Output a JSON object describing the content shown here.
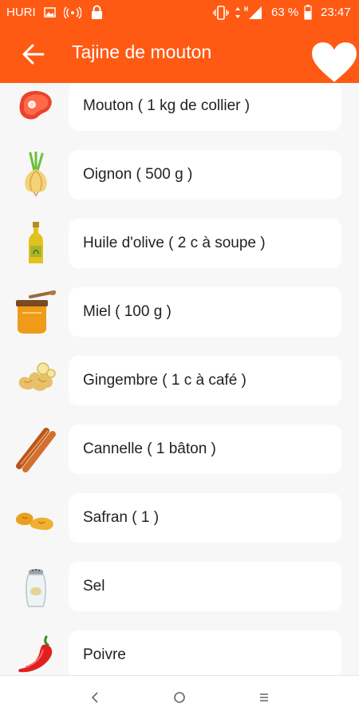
{
  "status_bar": {
    "carrier": "HURI",
    "battery": "63 %",
    "time": "23:47"
  },
  "header": {
    "title": "Tajine de mouton"
  },
  "ingredients": [
    {
      "label": "Mouton ( 1 kg de collier )",
      "icon": "meat-icon"
    },
    {
      "label": "Oignon ( 500 g )",
      "icon": "onion-icon"
    },
    {
      "label": "Huile d'olive ( 2 c à soupe )",
      "icon": "olive-oil-icon"
    },
    {
      "label": "Miel ( 100 g )",
      "icon": "honey-icon"
    },
    {
      "label": "Gingembre ( 1 c à café )",
      "icon": "ginger-icon"
    },
    {
      "label": "Cannelle ( 1 bâton )",
      "icon": "cinnamon-icon"
    },
    {
      "label": "Safran ( 1 )",
      "icon": "saffron-icon"
    },
    {
      "label": "Sel",
      "icon": "salt-icon"
    },
    {
      "label": "Poivre",
      "icon": "pepper-icon"
    }
  ],
  "colors": {
    "primary": "#ff5a14",
    "background": "#f7f7f7",
    "card": "#ffffff"
  }
}
